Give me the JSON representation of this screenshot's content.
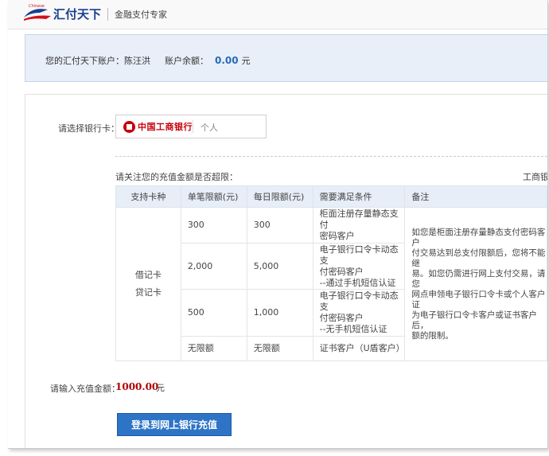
{
  "header": {
    "logo_small_text": "Chinese",
    "logo_text": "汇付天下",
    "slogan": "金融支付专家"
  },
  "account": {
    "label": "您的汇付天下账户：",
    "name": "陈汪洪",
    "balance_label": "账户余额：",
    "balance": "0.00",
    "currency": "元"
  },
  "bank": {
    "label": "请选择银行卡：",
    "name": "中国工商银行",
    "type": "个人"
  },
  "limits": {
    "intro": "请关注您的充值金额是否超限：",
    "right_note": "工商银",
    "headers": [
      "支持卡种",
      "单笔限额(元)",
      "每日限额(元)",
      "需要满足条件",
      "备注"
    ],
    "card_types": [
      "借记卡",
      "贷记卡"
    ],
    "rows": [
      {
        "single": "300",
        "daily": "300",
        "condition": [
          "柜面注册存量静态支付",
          "密码客户"
        ]
      },
      {
        "single": "2,000",
        "daily": "5,000",
        "condition": [
          "电子银行口令卡动态支",
          "付密码客户",
          "--通过手机短信认证"
        ]
      },
      {
        "single": "500",
        "daily": "1,000",
        "condition": [
          "电子银行口令卡动态支",
          "付密码客户",
          "--无手机短信认证"
        ]
      },
      {
        "single": "无限额",
        "daily": "无限额",
        "condition": [
          "证书客户（U盾客户）"
        ]
      }
    ],
    "note_lines": [
      "如您是柜面注册存量静态支付密码客户",
      "付交易达到总支付限额后，您将不能继",
      "易。如您仍需进行网上支付交易，请您",
      "网点申领电子银行口令卡或个人客户证",
      "为电子银行口令卡客户或证书客户后，",
      "额的限制。"
    ]
  },
  "recharge": {
    "label": "请输入充值金额：",
    "amount": "1000.00",
    "unit": "元",
    "button": "登录到网上银行充值"
  }
}
